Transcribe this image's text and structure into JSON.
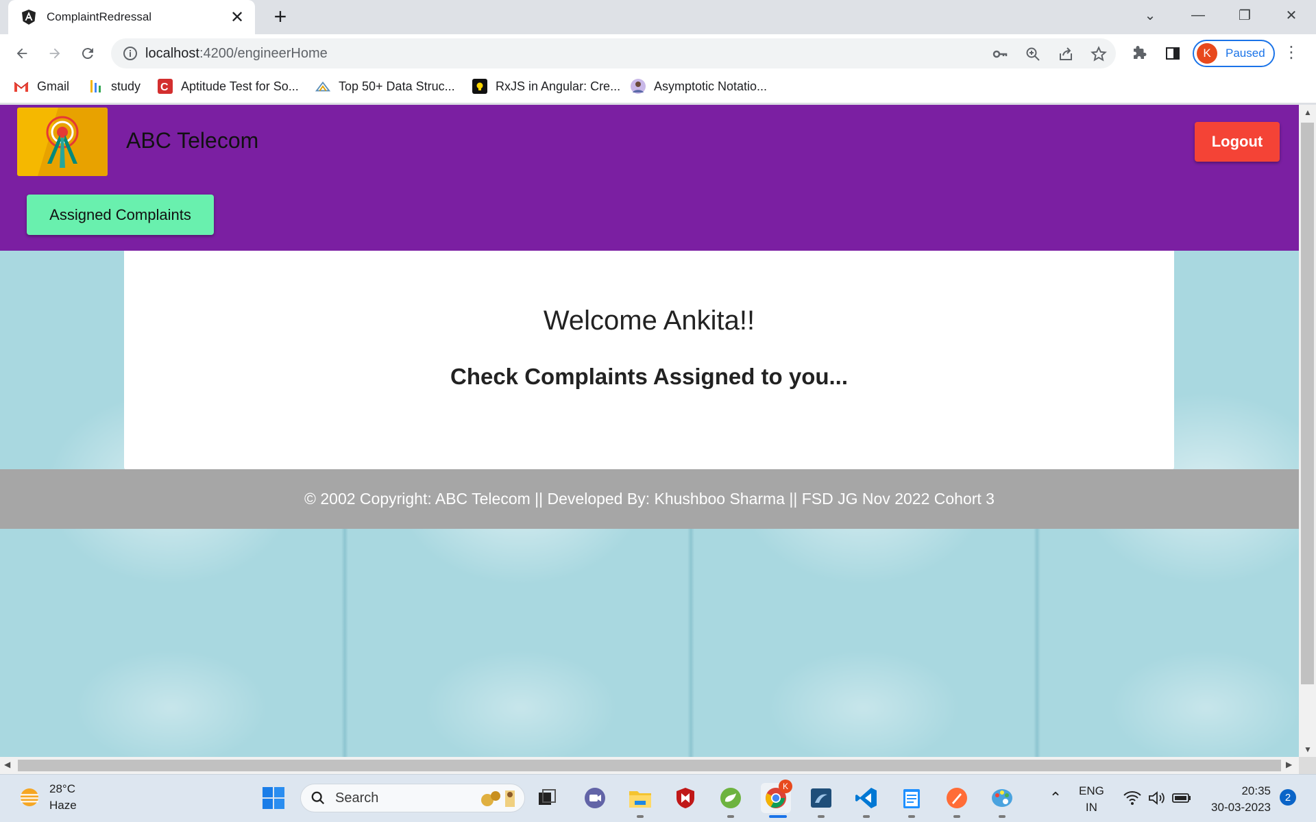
{
  "browser": {
    "tab_title": "ComplaintRedressal",
    "url_host": "localhost",
    "url_path": ":4200/engineerHome",
    "profile_initial": "K",
    "profile_status": "Paused",
    "bookmarks": [
      {
        "label": "Gmail",
        "icon": "gmail-icon"
      },
      {
        "label": "study",
        "icon": "study-icon"
      },
      {
        "label": "Aptitude Test for So...",
        "icon": "aptitude-icon"
      },
      {
        "label": "Top 50+ Data Struc...",
        "icon": "data-structures-icon"
      },
      {
        "label": "RxJS in Angular: Cre...",
        "icon": "rxjs-icon"
      },
      {
        "label": "Asymptotic Notatio...",
        "icon": "avatar-icon"
      }
    ]
  },
  "app": {
    "brand": "ABC Telecom",
    "logout_label": "Logout",
    "nav_assigned_label": "Assigned Complaints",
    "welcome": "Welcome Ankita!!",
    "subheading": "Check Complaints Assigned to you...",
    "footer": "© 2002 Copyright: ABC Telecom || Developed By: Khushboo Sharma || FSD JG Nov 2022 Cohort 3",
    "colors": {
      "header": "#7b1fa2",
      "logout": "#f44336",
      "nav_button": "#69f0ae",
      "footer": "#a6a6a6"
    }
  },
  "taskbar": {
    "temperature": "28°C",
    "weather": "Haze",
    "search_placeholder": "Search",
    "language": "ENG",
    "region": "IN",
    "time": "20:35",
    "date": "30-03-2023",
    "notification_count": "2",
    "chrome_badge": "K"
  }
}
